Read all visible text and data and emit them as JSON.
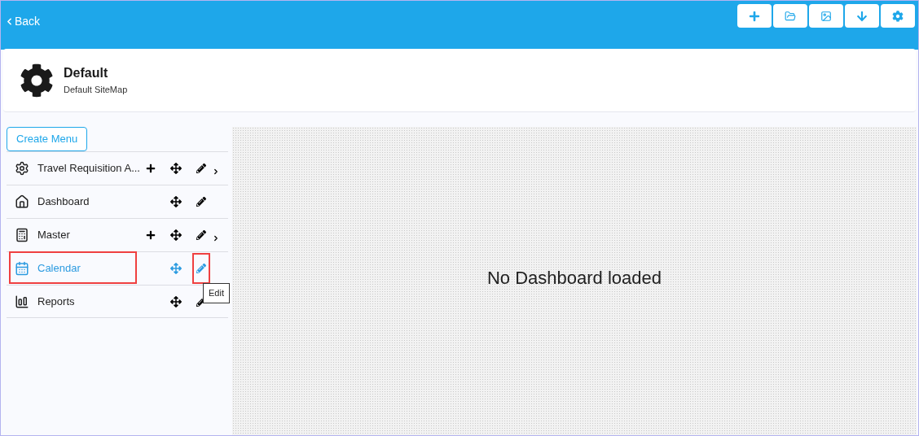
{
  "header": {
    "back": "Back",
    "toolbar": [
      {
        "kind": "add"
      },
      {
        "kind": "open"
      },
      {
        "kind": "image"
      },
      {
        "kind": "download"
      },
      {
        "kind": "settings"
      }
    ]
  },
  "title_card": {
    "title": "Default",
    "subtitle": "Default SiteMap"
  },
  "sidebar": {
    "create_button": "Create Menu",
    "items": [
      {
        "label": "Travel Requisition A...",
        "kind": "gear",
        "has_add": true,
        "has_children": true,
        "selected": false
      },
      {
        "label": "Dashboard",
        "kind": "home",
        "has_add": false,
        "has_children": false,
        "selected": false
      },
      {
        "label": "Master",
        "kind": "grid",
        "has_add": true,
        "has_children": true,
        "selected": false
      },
      {
        "label": "Calendar",
        "kind": "calendar",
        "has_add": false,
        "has_children": false,
        "selected": true
      },
      {
        "label": "Reports",
        "kind": "chart",
        "has_add": false,
        "has_children": false,
        "selected": false
      }
    ]
  },
  "tooltip": "Edit",
  "main": {
    "message": "No Dashboard loaded"
  }
}
